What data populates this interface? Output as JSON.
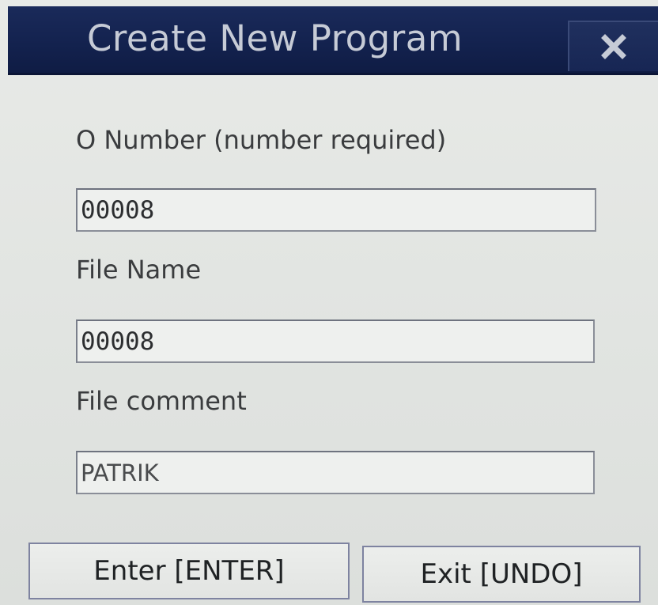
{
  "dialog": {
    "title": "Create New Program",
    "close_icon": "close-icon"
  },
  "form": {
    "o_number": {
      "label": "O Number (number required)",
      "value": "00008"
    },
    "file_name": {
      "label": "File Name",
      "value": "00008"
    },
    "file_comment": {
      "label": "File comment",
      "value": "PATRIK"
    }
  },
  "buttons": {
    "enter_label": "Enter [ENTER]",
    "exit_label": "Exit [UNDO]"
  },
  "colors": {
    "titlebar": "#142350",
    "title_text": "#c6cbd6",
    "background": "#e2e5e2"
  }
}
